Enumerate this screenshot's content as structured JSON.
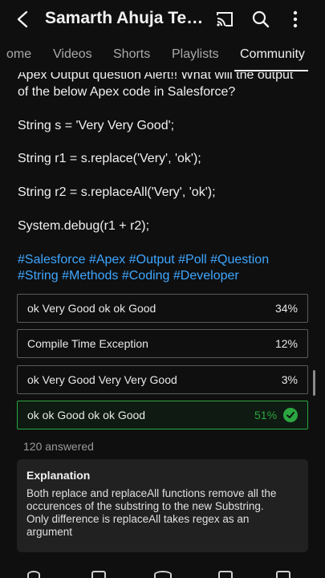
{
  "header": {
    "channel_title": "Samarth Ahuja Tech...",
    "back_icon": "arrow-back-icon",
    "cast_icon": "cast-icon",
    "search_icon": "search-icon",
    "more_icon": "more-vert-icon"
  },
  "tabs": [
    {
      "label": "ome",
      "active": false
    },
    {
      "label": "Videos",
      "active": false
    },
    {
      "label": "Shorts",
      "active": false
    },
    {
      "label": "Playlists",
      "active": false
    },
    {
      "label": "Community",
      "active": true
    }
  ],
  "post": {
    "lines": [
      "Apex Output question Alert!! What will the output",
      "of the below Apex code in Salesforce?",
      "String s = 'Very Very Good';",
      "String r1 = s.replace('Very', 'ok');",
      "String r2 = s.replaceAll('Very', 'ok');",
      "System.debug(r1 + r2);"
    ],
    "hashtag_lines": [
      "#Salesforce #Apex #Output #Poll #Question",
      "#String #Methods #Coding #Developer"
    ]
  },
  "poll": {
    "options": [
      {
        "text": "ok Very Good ok ok Good",
        "percent": "34%",
        "correct": false
      },
      {
        "text": "Compile Time Exception",
        "percent": "12%",
        "correct": false
      },
      {
        "text": "ok Very Good Very Very Good",
        "percent": "3%",
        "correct": false
      },
      {
        "text": "ok ok Good ok ok Good",
        "percent": "51%",
        "correct": true
      }
    ],
    "answered": "120 answered"
  },
  "explanation": {
    "title": "Explanation",
    "body_lines": [
      "Both replace and replaceAll functions remove all the",
      "occurences of the substring to the new Substring.",
      "Only difference is replaceAll takes regex as an",
      "argument"
    ]
  },
  "colors": {
    "background": "#0f0f0f",
    "link": "#3ea6ff",
    "correct": "#2ba640",
    "card": "#212121"
  }
}
